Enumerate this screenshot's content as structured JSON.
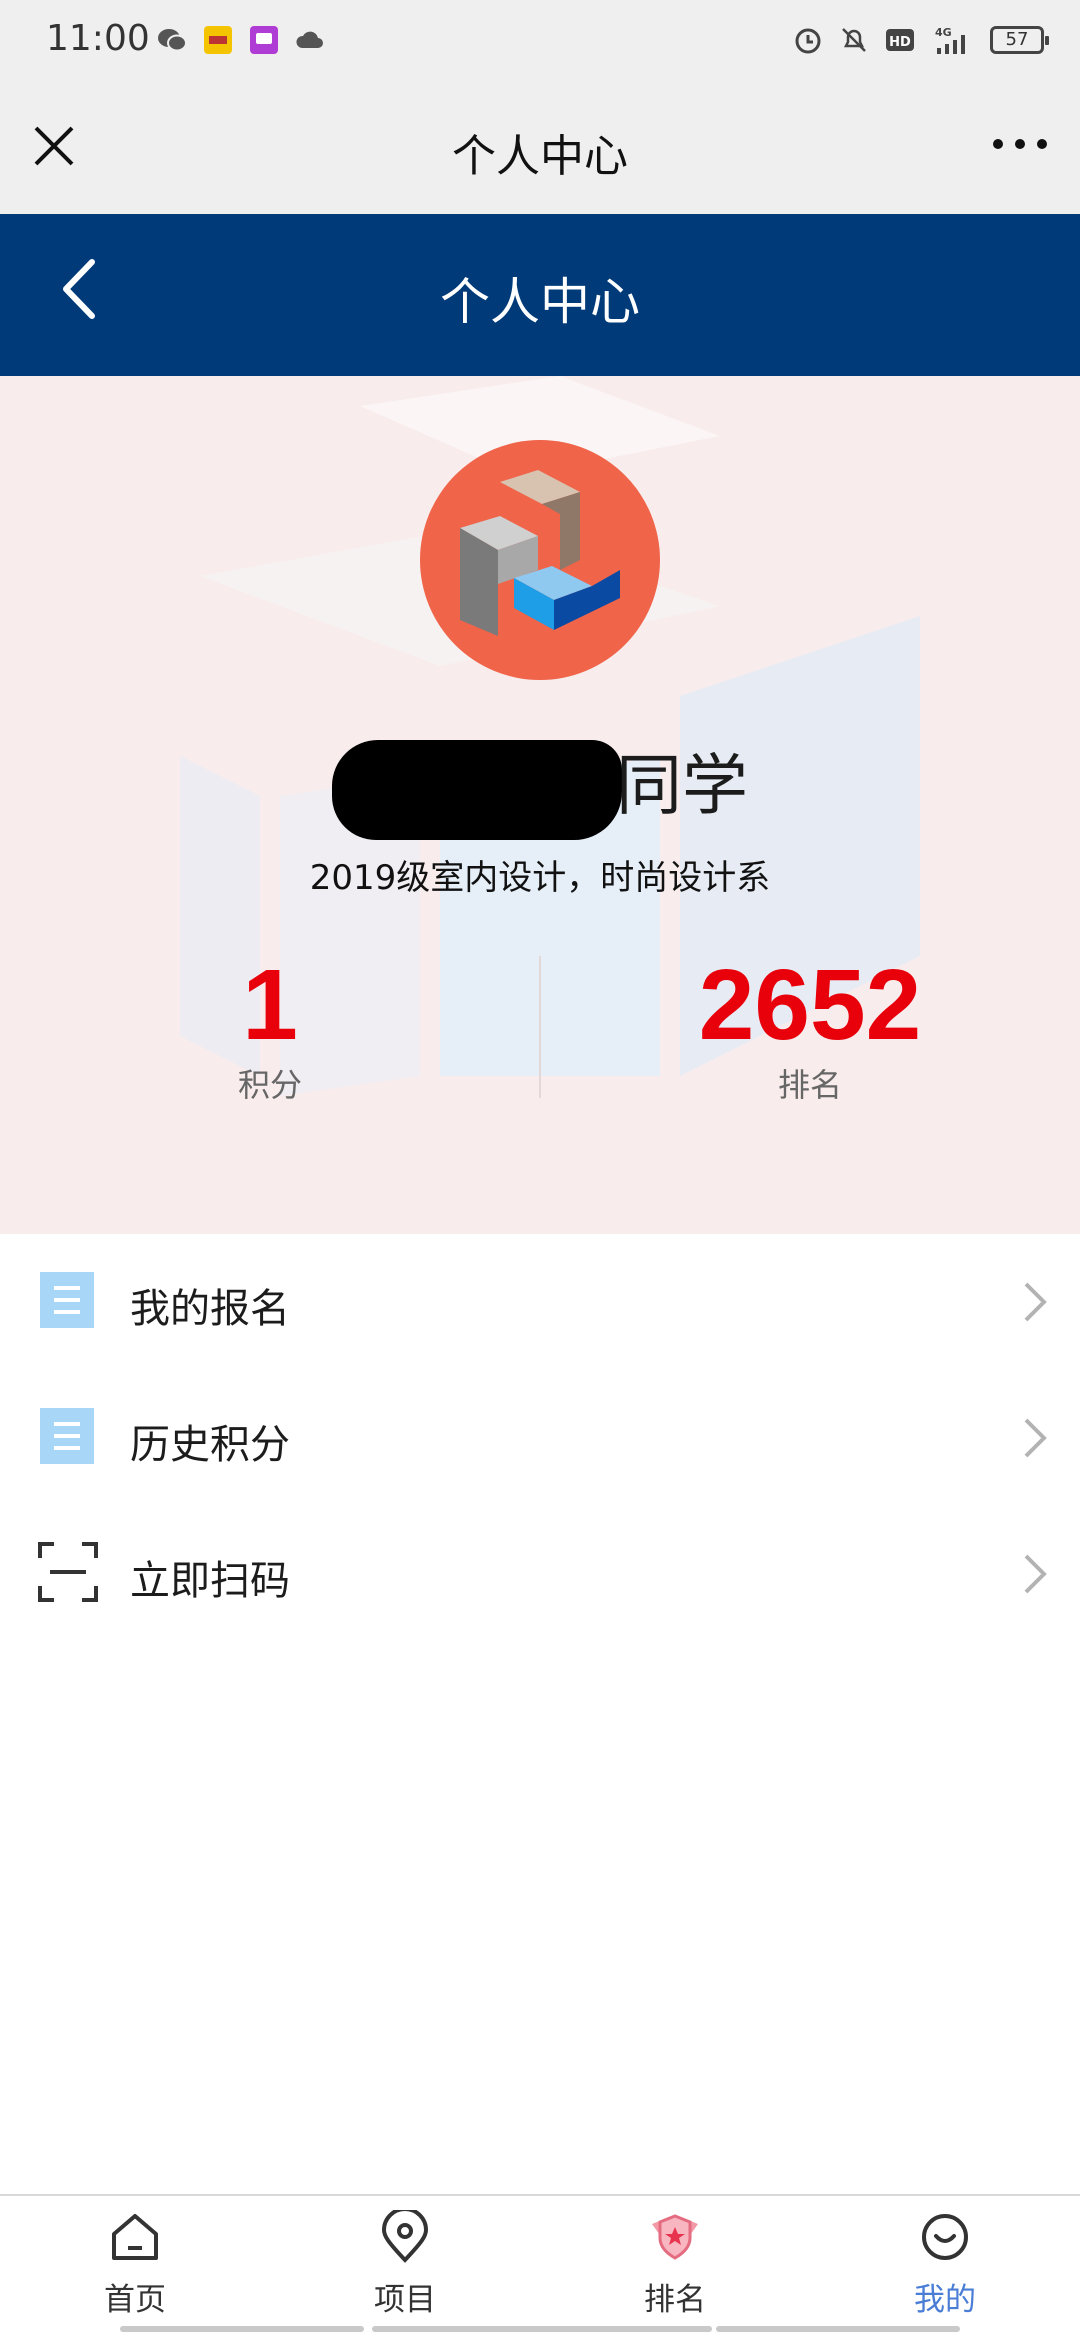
{
  "status_bar": {
    "time": "11:00",
    "left_icons": [
      "wechat-icon",
      "app-badge-icon",
      "video-app-icon",
      "cloud-icon"
    ],
    "right_icons": [
      "alarm-icon",
      "bell-off-icon",
      "hd-icon",
      "signal-4g-icon"
    ],
    "battery_level": "57"
  },
  "app_header": {
    "title": "个人中心"
  },
  "page_header": {
    "title": "个人中心"
  },
  "profile": {
    "name_suffix": "同学",
    "class_info": "2019级室内设计，时尚设计系",
    "points_value": "1",
    "points_label": "积分",
    "rank_value": "2652",
    "rank_label": "排名"
  },
  "menu": [
    {
      "label": "我的报名",
      "icon": "document-icon"
    },
    {
      "label": "历史积分",
      "icon": "document-icon"
    },
    {
      "label": "立即扫码",
      "icon": "scan-icon"
    }
  ],
  "tabbar": [
    {
      "label": "首页",
      "icon": "home-icon"
    },
    {
      "label": "项目",
      "icon": "location-pin-icon"
    },
    {
      "label": "排名",
      "icon": "ranking-badge-icon"
    },
    {
      "label": "我的",
      "icon": "smile-face-icon",
      "active": true
    }
  ],
  "colors": {
    "header_blue": "#003a78",
    "avatar_bg": "#f0644a",
    "stat_red": "#e8000b",
    "active_tab": "#4a7ed6",
    "profile_bg": "#f8ecec"
  }
}
